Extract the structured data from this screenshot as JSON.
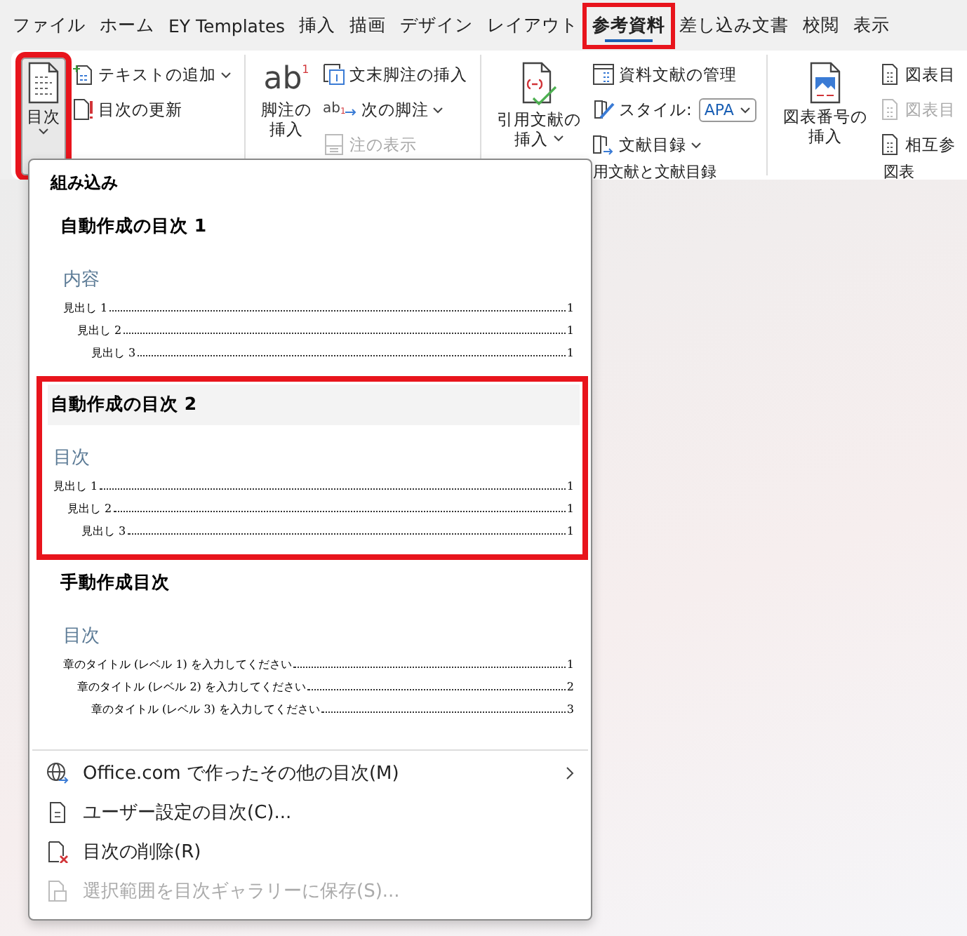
{
  "tabs": [
    {
      "label": "ファイル",
      "selected": false,
      "highlighted": false
    },
    {
      "label": "ホーム",
      "selected": false,
      "highlighted": false
    },
    {
      "label": "EY Templates",
      "selected": false,
      "highlighted": false
    },
    {
      "label": "挿入",
      "selected": false,
      "highlighted": false
    },
    {
      "label": "描画",
      "selected": false,
      "highlighted": false
    },
    {
      "label": "デザイン",
      "selected": false,
      "highlighted": false
    },
    {
      "label": "レイアウト",
      "selected": false,
      "highlighted": false
    },
    {
      "label": "参考資料",
      "selected": true,
      "highlighted": true
    },
    {
      "label": "差し込み文書",
      "selected": false,
      "highlighted": false
    },
    {
      "label": "校閲",
      "selected": false,
      "highlighted": false
    },
    {
      "label": "表示",
      "selected": false,
      "highlighted": false
    }
  ],
  "ribbon": {
    "groups": [
      {
        "large": {
          "lines": [
            "目次"
          ],
          "dropdown": true,
          "highlighted": true
        },
        "small": [
          {
            "label": "テキストの追加",
            "dropdown": true,
            "disabled": false
          },
          {
            "label": "目次の更新",
            "dropdown": false,
            "disabled": false
          }
        ]
      },
      {
        "large": {
          "lines": [
            "脚注の",
            "挿入"
          ],
          "glyph": "ab",
          "glyph_mark": "1",
          "dropdown": false,
          "highlighted": false
        },
        "small": [
          {
            "label": "文末脚注の挿入",
            "dropdown": false,
            "disabled": false
          },
          {
            "label": "次の脚注",
            "glyph": "ab",
            "glyph_mark": "1",
            "dropdown": true,
            "disabled": false
          },
          {
            "label": "注の表示",
            "dropdown": false,
            "disabled": true
          }
        ]
      },
      {
        "label": "用文献と文献目録",
        "large": {
          "lines": [
            "引用文献の",
            "挿入"
          ],
          "dropdown": true,
          "highlighted": false
        },
        "small": [
          {
            "label": "資料文献の管理",
            "dropdown": false,
            "disabled": false
          },
          {
            "label": "スタイル:",
            "combo": "APA",
            "dropdown": false,
            "disabled": false
          },
          {
            "label": "文献目録",
            "dropdown": true,
            "disabled": false
          }
        ]
      },
      {
        "label": "図表",
        "large": {
          "lines": [
            "図表番号の",
            "挿入"
          ],
          "dropdown": false,
          "highlighted": false
        },
        "small": [
          {
            "label": "図表目",
            "dropdown": false,
            "disabled": false
          },
          {
            "label": "図表目",
            "dropdown": false,
            "disabled": true
          },
          {
            "label": "相互参",
            "dropdown": false,
            "disabled": false
          }
        ]
      }
    ]
  },
  "menu": {
    "section": "組み込み",
    "gallery": [
      {
        "title": "自動作成の目次 1",
        "highlighted": false,
        "heading": "内容",
        "entries": [
          {
            "text": "見出し 1",
            "page": "1",
            "children": [
              {
                "text": "見出し 2",
                "page": "1",
                "children": [
                  {
                    "text": "見出し 3",
                    "page": "1"
                  }
                ]
              }
            ]
          }
        ]
      },
      {
        "title": "自動作成の目次 2",
        "highlighted": true,
        "heading": "目次",
        "entries": [
          {
            "text": "見出し 1",
            "page": "1",
            "children": [
              {
                "text": "見出し 2",
                "page": "1",
                "children": [
                  {
                    "text": "見出し 3",
                    "page": "1"
                  }
                ]
              }
            ]
          }
        ]
      },
      {
        "title": "手動作成目次",
        "highlighted": false,
        "heading": "目次",
        "entries": [
          {
            "text": "章のタイトル (レベル 1) を入力してください",
            "page": "1",
            "children": [
              {
                "text": "章のタイトル (レベル 2) を入力してください",
                "page": "2",
                "children": [
                  {
                    "text": "章のタイトル (レベル 3) を入力してください",
                    "page": "3"
                  }
                ]
              }
            ]
          }
        ]
      }
    ],
    "commands": [
      {
        "label": "Office.com で作ったその他の目次(M)",
        "submenu": true,
        "disabled": false
      },
      {
        "label": "ユーザー設定の目次(C)...",
        "submenu": false,
        "disabled": false
      },
      {
        "label": "目次の削除(R)",
        "submenu": false,
        "disabled": false
      },
      {
        "label": "選択範囲を目次ギャラリーに保存(S)...",
        "submenu": false,
        "disabled": true
      }
    ]
  }
}
